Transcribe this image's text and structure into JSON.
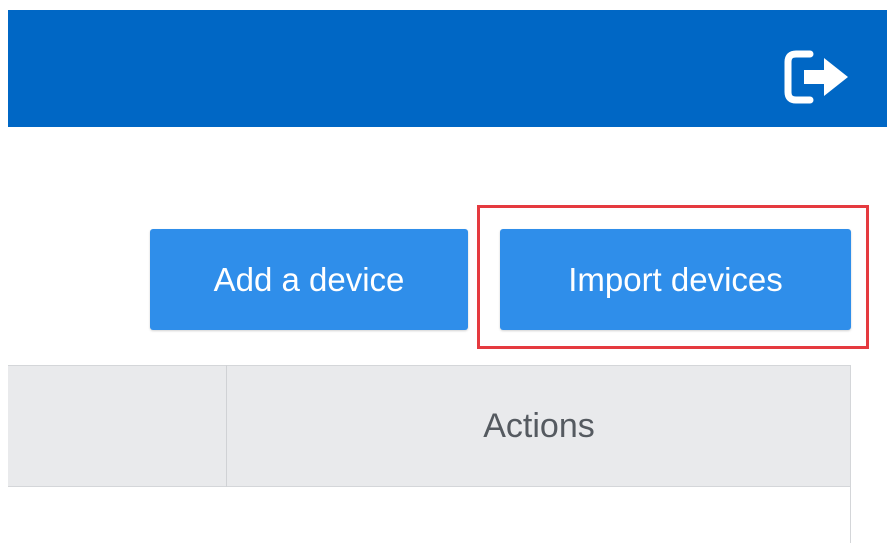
{
  "topbar": {
    "logout_icon": "logout-icon",
    "color": "#0067c5"
  },
  "toolbar": {
    "add_label": "Add a device",
    "import_label": "Import devices",
    "button_color": "#2f8eea"
  },
  "table": {
    "columns": [
      "",
      "Actions"
    ]
  },
  "highlight": {
    "color": "#e53a3f"
  }
}
